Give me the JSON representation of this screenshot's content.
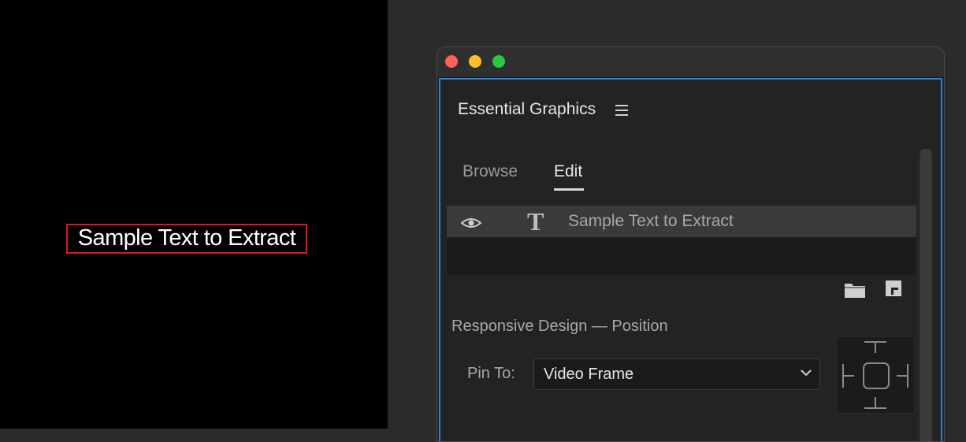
{
  "preview": {
    "selected_text": "Sample Text to Extract"
  },
  "panel": {
    "title": "Essential Graphics",
    "tabs": [
      {
        "label": "Browse",
        "active": false
      },
      {
        "label": "Edit",
        "active": true
      }
    ],
    "layers": [
      {
        "name": "Sample Text to Extract",
        "type": "text",
        "visible": true
      }
    ],
    "responsive_section_title": "Responsive Design — Position",
    "pin_to_label": "Pin To:",
    "pin_to_value": "Video Frame"
  },
  "colors": {
    "selection_border": "#e4161b",
    "panel_focus_border": "#2d7fd8"
  }
}
